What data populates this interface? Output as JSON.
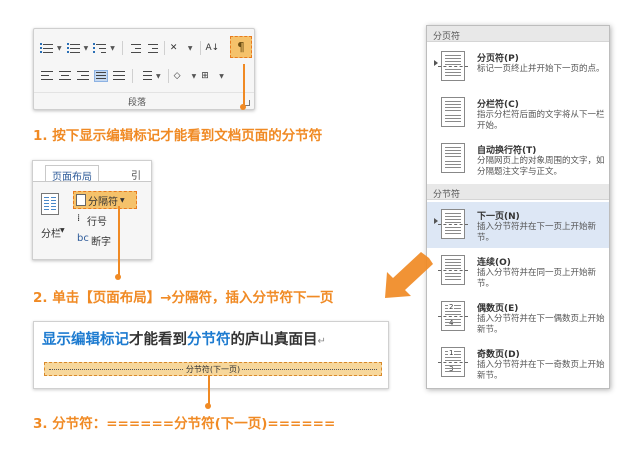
{
  "ribbon": {
    "group_label": "段落",
    "pilcrow_icon": "show-hide-marks-icon",
    "colors": {
      "highlight": "#f5c26b",
      "accent": "#f08a24"
    }
  },
  "steps": {
    "step1": "1. 按下显示编辑标记才能看到文档页面的分节符",
    "step2": "2. 单击【页面布局】→分隔符，插入分节符下一页",
    "step3": "3. 分节符：======分节符(下一页)======"
  },
  "layout_panel": {
    "tab_label": "页面布局",
    "next_tab_label": "引",
    "columns_label": "分栏",
    "separator_button": "分隔符",
    "line_number": "行号",
    "hyphenation": "断字"
  },
  "sample": {
    "part1": "显示编辑标记",
    "part2": "才能看到",
    "part3": "分节符",
    "part4": "的庐山真面目",
    "para_mark": "↵",
    "section_break": "分节符(下一页)"
  },
  "menu": {
    "header_page_breaks": "分页符",
    "header_section_breaks": "分节符",
    "items": [
      {
        "title": "分页符(P)",
        "desc": "标记一页终止并开始下一页的点。"
      },
      {
        "title": "分栏符(C)",
        "desc": "指示分栏符后面的文字将从下一栏开始。"
      },
      {
        "title": "自动换行符(T)",
        "desc": "分隔网页上的对象周围的文字，如分隔题注文字与正文。"
      },
      {
        "title": "下一页(N)",
        "desc": "插入分节符并在下一页上开始新节。"
      },
      {
        "title": "连续(O)",
        "desc": "插入分节符并在同一页上开始新节。"
      },
      {
        "title": "偶数页(E)",
        "desc": "插入分节符并在下一偶数页上开始新节。"
      },
      {
        "title": "奇数页(D)",
        "desc": "插入分节符并在下一奇数页上开始新节。"
      }
    ],
    "even_num": "2",
    "even_num2": "4",
    "odd_num": "1",
    "odd_num2": "3"
  }
}
